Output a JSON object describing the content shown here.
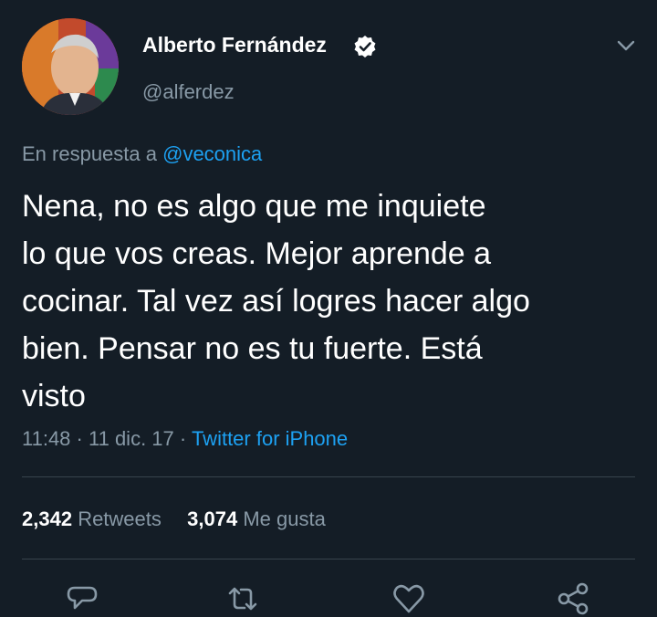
{
  "tweet": {
    "author": {
      "name": "Alberto Fernández",
      "handle": "@alferdez",
      "verified": true
    },
    "reply_prefix": "En respuesta a",
    "reply_to": "@veconica",
    "text_lines": [
      "Nena, no es algo que me inquiete",
      "lo que vos creas. Mejor aprende a",
      "cocinar. Tal vez así logres hacer algo",
      "bien. Pensar no es tu fuerte. Está",
      "visto"
    ],
    "time": "11:48",
    "date": "11 dic. 17",
    "separator": "·",
    "source": "Twitter for iPhone"
  },
  "stats": {
    "retweets_count": "2,342",
    "retweets_label": "Retweets",
    "likes_count": "3,074",
    "likes_label": "Me gusta"
  },
  "icons": {
    "verified": "verified-badge-icon",
    "menu": "chevron-down-icon",
    "actions": [
      "reply-icon",
      "retweet-icon",
      "like-icon",
      "share-icon"
    ]
  },
  "colors": {
    "background": "#141d26",
    "text": "#ffffff",
    "secondary": "#8899a6",
    "accent": "#1da1f2",
    "divider": "#38444d"
  }
}
